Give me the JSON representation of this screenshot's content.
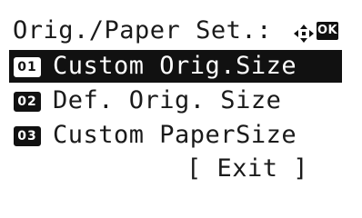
{
  "screen": {
    "title": "Orig./Paper Set.:",
    "nav_icon": "four-way-arrow-icon",
    "ok_label": "OK"
  },
  "menu": {
    "items": [
      {
        "number": "01",
        "label": "Custom Orig.Size",
        "selected": true
      },
      {
        "number": "02",
        "label": "Def. Orig. Size",
        "selected": false
      },
      {
        "number": "03",
        "label": "Custom PaperSize",
        "selected": false
      }
    ]
  },
  "exit": {
    "label": "[ Exit ]"
  },
  "colors": {
    "foreground": "#1a1a1a",
    "background": "#ffffff",
    "highlight": "#111111"
  }
}
